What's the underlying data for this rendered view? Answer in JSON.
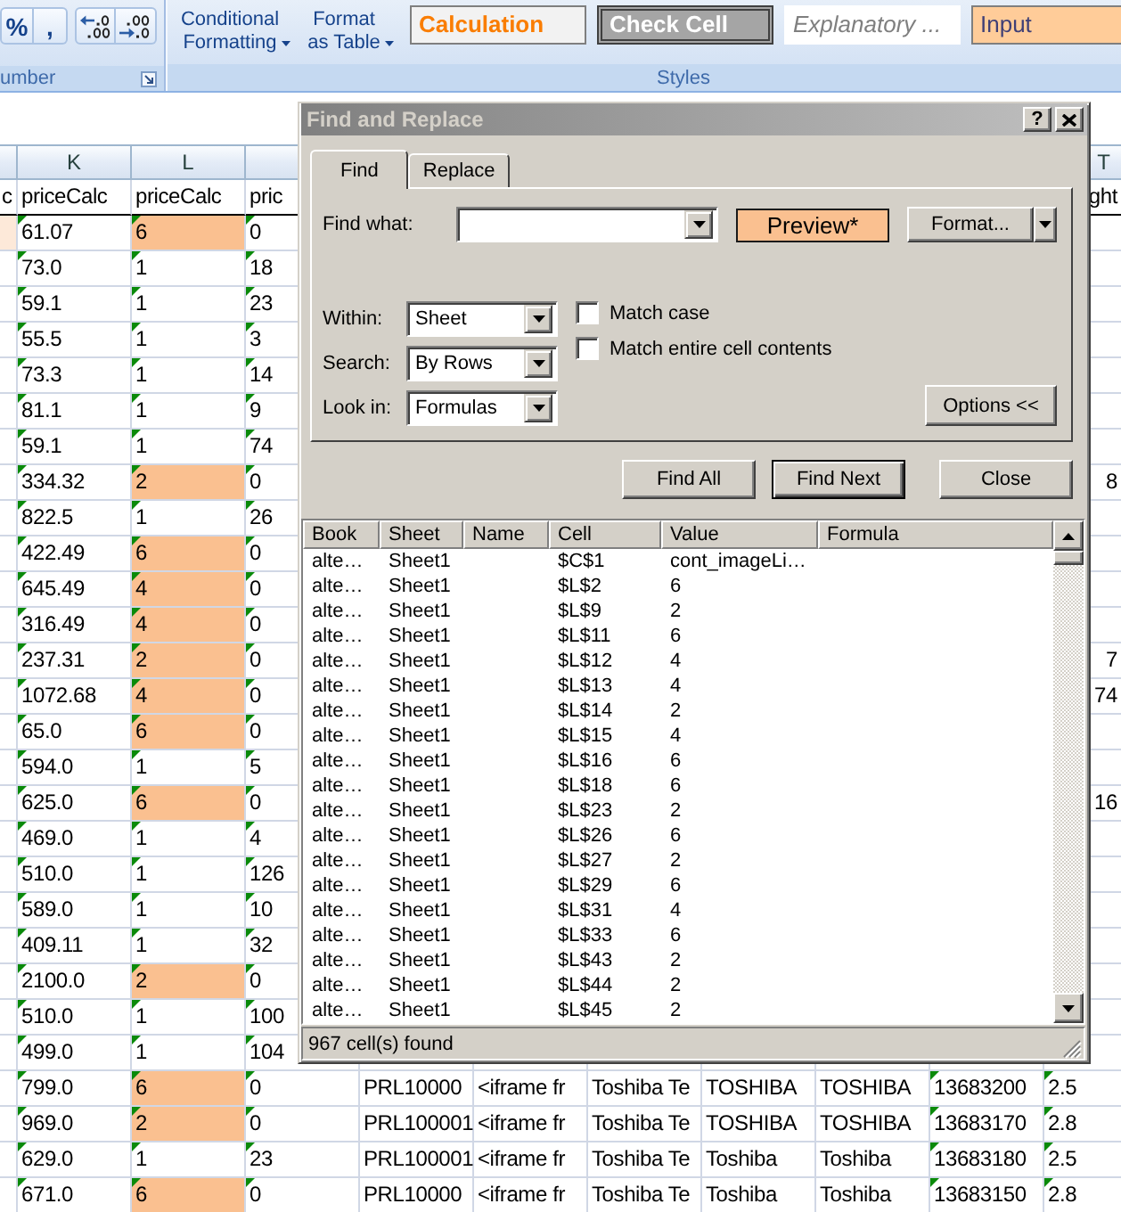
{
  "ribbon": {
    "number_group": {
      "label": "umber",
      "button_sets": [
        {
          "buttons": [
            {
              "kind": "symbol",
              "label": "%"
            },
            {
              "kind": "symbol",
              "label": ","
            }
          ]
        },
        {
          "buttons": [
            {
              "kind": "add_decimal"
            },
            {
              "kind": "remove_decimal"
            }
          ]
        }
      ]
    },
    "styles_group": {
      "label": "Styles",
      "commands": [
        {
          "label": "Conditional Formatting"
        },
        {
          "label": "Format as Table"
        }
      ],
      "cell_styles": [
        {
          "kind": "calculation",
          "label": "Calculation"
        },
        {
          "kind": "check",
          "label": "Check Cell"
        },
        {
          "kind": "explanatory",
          "label": "Explanatory ..."
        },
        {
          "kind": "input",
          "label": "Input"
        }
      ]
    }
  },
  "sheet": {
    "column_headers": [
      {
        "letter": "K"
      },
      {
        "letter": "L"
      }
    ],
    "edge_column_header": {
      "letter": "T"
    },
    "rows": [
      {
        "kind": "header",
        "lead": {
          "text": "c",
          "highlight": false
        },
        "cells": [
          {
            "text": "priceCalc",
            "highlight": false,
            "error_flag": false
          },
          {
            "text": "priceCalc",
            "highlight": false,
            "error_flag": false
          },
          {
            "text": "pric",
            "highlight": false,
            "error_flag": false
          }
        ],
        "edge": {
          "text": "ght"
        }
      },
      {
        "kind": "data",
        "lead": {
          "highlight": true
        },
        "cells": [
          {
            "text": "61.07",
            "highlight": false,
            "error_flag": true
          },
          {
            "text": "6",
            "highlight": true,
            "error_flag": true
          },
          {
            "text": "0",
            "highlight": false,
            "error_flag": true
          }
        ]
      },
      {
        "kind": "data",
        "cells": [
          {
            "text": "73.0",
            "highlight": false,
            "error_flag": true
          },
          {
            "text": "1",
            "highlight": false,
            "error_flag": true
          },
          {
            "text": "18",
            "highlight": false,
            "error_flag": true
          }
        ]
      },
      {
        "kind": "data",
        "cells": [
          {
            "text": "59.1",
            "highlight": false,
            "error_flag": true
          },
          {
            "text": "1",
            "highlight": false,
            "error_flag": true
          },
          {
            "text": "23",
            "highlight": false,
            "error_flag": true
          }
        ]
      },
      {
        "kind": "data",
        "cells": [
          {
            "text": "55.5",
            "highlight": false,
            "error_flag": true
          },
          {
            "text": "1",
            "highlight": false,
            "error_flag": true
          },
          {
            "text": "3",
            "highlight": false,
            "error_flag": true
          }
        ]
      },
      {
        "kind": "data",
        "cells": [
          {
            "text": "73.3",
            "highlight": false,
            "error_flag": true
          },
          {
            "text": "1",
            "highlight": false,
            "error_flag": true
          },
          {
            "text": "14",
            "highlight": false,
            "error_flag": true
          }
        ]
      },
      {
        "kind": "data",
        "cells": [
          {
            "text": "81.1",
            "highlight": false,
            "error_flag": true
          },
          {
            "text": "1",
            "highlight": false,
            "error_flag": true
          },
          {
            "text": "9",
            "highlight": false,
            "error_flag": true
          }
        ]
      },
      {
        "kind": "data",
        "cells": [
          {
            "text": "59.1",
            "highlight": false,
            "error_flag": true
          },
          {
            "text": "1",
            "highlight": false,
            "error_flag": true
          },
          {
            "text": "74",
            "highlight": false,
            "error_flag": true
          }
        ]
      },
      {
        "kind": "data",
        "cells": [
          {
            "text": "334.32",
            "highlight": false,
            "error_flag": true
          },
          {
            "text": "2",
            "highlight": true,
            "error_flag": true
          },
          {
            "text": "0",
            "highlight": false,
            "error_flag": true
          }
        ],
        "edge": {
          "text": "8"
        }
      },
      {
        "kind": "data",
        "cells": [
          {
            "text": "822.5",
            "highlight": false,
            "error_flag": true
          },
          {
            "text": "1",
            "highlight": false,
            "error_flag": true
          },
          {
            "text": "26",
            "highlight": false,
            "error_flag": true
          }
        ]
      },
      {
        "kind": "data",
        "cells": [
          {
            "text": "422.49",
            "highlight": false,
            "error_flag": true
          },
          {
            "text": "6",
            "highlight": true,
            "error_flag": true
          },
          {
            "text": "0",
            "highlight": false,
            "error_flag": true
          }
        ]
      },
      {
        "kind": "data",
        "cells": [
          {
            "text": "645.49",
            "highlight": false,
            "error_flag": true
          },
          {
            "text": "4",
            "highlight": true,
            "error_flag": true
          },
          {
            "text": "0",
            "highlight": false,
            "error_flag": true
          }
        ]
      },
      {
        "kind": "data",
        "cells": [
          {
            "text": "316.49",
            "highlight": false,
            "error_flag": true
          },
          {
            "text": "4",
            "highlight": true,
            "error_flag": true
          },
          {
            "text": "0",
            "highlight": false,
            "error_flag": true
          }
        ]
      },
      {
        "kind": "data",
        "cells": [
          {
            "text": "237.31",
            "highlight": false,
            "error_flag": true
          },
          {
            "text": "2",
            "highlight": true,
            "error_flag": true
          },
          {
            "text": "0",
            "highlight": false,
            "error_flag": true
          }
        ],
        "edge": {
          "text": "7"
        }
      },
      {
        "kind": "data",
        "cells": [
          {
            "text": "1072.68",
            "highlight": false,
            "error_flag": true
          },
          {
            "text": "4",
            "highlight": true,
            "error_flag": true
          },
          {
            "text": "0",
            "highlight": false,
            "error_flag": true
          }
        ],
        "edge": {
          "text": "74"
        }
      },
      {
        "kind": "data",
        "cells": [
          {
            "text": "65.0",
            "highlight": false,
            "error_flag": true
          },
          {
            "text": "6",
            "highlight": true,
            "error_flag": true
          },
          {
            "text": "0",
            "highlight": false,
            "error_flag": true
          }
        ]
      },
      {
        "kind": "data",
        "cells": [
          {
            "text": "594.0",
            "highlight": false,
            "error_flag": true
          },
          {
            "text": "1",
            "highlight": false,
            "error_flag": true
          },
          {
            "text": "5",
            "highlight": false,
            "error_flag": true
          }
        ]
      },
      {
        "kind": "data",
        "cells": [
          {
            "text": "625.0",
            "highlight": false,
            "error_flag": true
          },
          {
            "text": "6",
            "highlight": true,
            "error_flag": true
          },
          {
            "text": "0",
            "highlight": false,
            "error_flag": true
          }
        ],
        "edge": {
          "text": "16"
        }
      },
      {
        "kind": "data",
        "cells": [
          {
            "text": "469.0",
            "highlight": false,
            "error_flag": true
          },
          {
            "text": "1",
            "highlight": false,
            "error_flag": true
          },
          {
            "text": "4",
            "highlight": false,
            "error_flag": true
          }
        ]
      },
      {
        "kind": "data",
        "cells": [
          {
            "text": "510.0",
            "highlight": false,
            "error_flag": true
          },
          {
            "text": "1",
            "highlight": false,
            "error_flag": true
          },
          {
            "text": "126",
            "highlight": false,
            "error_flag": true
          }
        ]
      },
      {
        "kind": "data",
        "cells": [
          {
            "text": "589.0",
            "highlight": false,
            "error_flag": true
          },
          {
            "text": "1",
            "highlight": false,
            "error_flag": true
          },
          {
            "text": "10",
            "highlight": false,
            "error_flag": true
          }
        ]
      },
      {
        "kind": "data",
        "cells": [
          {
            "text": "409.11",
            "highlight": false,
            "error_flag": true
          },
          {
            "text": "1",
            "highlight": false,
            "error_flag": true
          },
          {
            "text": "32",
            "highlight": false,
            "error_flag": true
          }
        ]
      },
      {
        "kind": "data",
        "cells": [
          {
            "text": "2100.0",
            "highlight": false,
            "error_flag": true
          },
          {
            "text": "2",
            "highlight": true,
            "error_flag": true
          },
          {
            "text": "0",
            "highlight": false,
            "error_flag": true
          }
        ]
      },
      {
        "kind": "data",
        "cells": [
          {
            "text": "510.0",
            "highlight": false,
            "error_flag": true
          },
          {
            "text": "1",
            "highlight": false,
            "error_flag": true
          },
          {
            "text": "100",
            "highlight": false,
            "error_flag": true
          }
        ]
      },
      {
        "kind": "data",
        "cells": [
          {
            "text": "499.0",
            "highlight": false,
            "error_flag": true
          },
          {
            "text": "1",
            "highlight": false,
            "error_flag": true
          },
          {
            "text": "104",
            "highlight": false,
            "error_flag": true
          }
        ]
      },
      {
        "kind": "data",
        "cells": [
          {
            "text": "799.0",
            "highlight": false,
            "error_flag": true
          },
          {
            "text": "6",
            "highlight": true,
            "error_flag": true
          },
          {
            "text": "0",
            "highlight": false,
            "error_flag": true
          },
          {
            "text": "PRL10000",
            "highlight": false,
            "error_flag": false
          },
          {
            "text": "<iframe fr",
            "highlight": false,
            "error_flag": false
          },
          {
            "text": "Toshiba Te",
            "highlight": false,
            "error_flag": false
          },
          {
            "text": "TOSHIBA",
            "highlight": false,
            "error_flag": false
          },
          {
            "text": "TOSHIBA",
            "highlight": false,
            "error_flag": false
          },
          {
            "text": "13683200",
            "highlight": false,
            "error_flag": true
          },
          {
            "text": "2.5",
            "highlight": false,
            "error_flag": true
          }
        ]
      },
      {
        "kind": "data",
        "cells": [
          {
            "text": "969.0",
            "highlight": false,
            "error_flag": true
          },
          {
            "text": "2",
            "highlight": true,
            "error_flag": true
          },
          {
            "text": "0",
            "highlight": false,
            "error_flag": true
          },
          {
            "text": "PRL100001",
            "highlight": false,
            "error_flag": false
          },
          {
            "text": "<iframe fr",
            "highlight": false,
            "error_flag": false
          },
          {
            "text": "Toshiba Te",
            "highlight": false,
            "error_flag": false
          },
          {
            "text": "TOSHIBA",
            "highlight": false,
            "error_flag": false
          },
          {
            "text": "TOSHIBA",
            "highlight": false,
            "error_flag": false
          },
          {
            "text": "13683170",
            "highlight": false,
            "error_flag": true
          },
          {
            "text": "2.8",
            "highlight": false,
            "error_flag": true
          }
        ]
      },
      {
        "kind": "data",
        "cells": [
          {
            "text": "629.0",
            "highlight": false,
            "error_flag": true
          },
          {
            "text": "1",
            "highlight": false,
            "error_flag": true
          },
          {
            "text": "23",
            "highlight": false,
            "error_flag": true
          },
          {
            "text": "PRL100001",
            "highlight": false,
            "error_flag": false
          },
          {
            "text": "<iframe fr",
            "highlight": false,
            "error_flag": false
          },
          {
            "text": "Toshiba Te",
            "highlight": false,
            "error_flag": false
          },
          {
            "text": "Toshiba",
            "highlight": false,
            "error_flag": false
          },
          {
            "text": "Toshiba",
            "highlight": false,
            "error_flag": false
          },
          {
            "text": "13683180",
            "highlight": false,
            "error_flag": true
          },
          {
            "text": "2.5",
            "highlight": false,
            "error_flag": true
          }
        ]
      },
      {
        "kind": "data",
        "cells": [
          {
            "text": "671.0",
            "highlight": false,
            "error_flag": true
          },
          {
            "text": "6",
            "highlight": true,
            "error_flag": true
          },
          {
            "text": "0",
            "highlight": false,
            "error_flag": true
          },
          {
            "text": "PRL10000",
            "highlight": false,
            "error_flag": false
          },
          {
            "text": "<iframe fr",
            "highlight": false,
            "error_flag": false
          },
          {
            "text": "Toshiba Te",
            "highlight": false,
            "error_flag": false
          },
          {
            "text": "Toshiba",
            "highlight": false,
            "error_flag": false
          },
          {
            "text": "Toshiba",
            "highlight": false,
            "error_flag": false
          },
          {
            "text": "13683150",
            "highlight": false,
            "error_flag": true
          },
          {
            "text": "2.8",
            "highlight": false,
            "error_flag": true
          }
        ]
      }
    ]
  },
  "dialog": {
    "title": "Find and Replace",
    "help_button": "?",
    "tabs": [
      {
        "label": "Find",
        "selected": true
      },
      {
        "label": "Replace",
        "selected": false
      }
    ],
    "find_what": {
      "label": "Find what:"
    },
    "format_preview": "Preview*",
    "format_button": "Format...",
    "options": [
      {
        "label": "Within:",
        "value": "Sheet"
      },
      {
        "label": "Search:",
        "value": "By Rows"
      },
      {
        "label": "Look in:",
        "value": "Formulas"
      }
    ],
    "checkboxes": [
      {
        "label": "Match case",
        "checked": false
      },
      {
        "label": "Match entire cell contents",
        "checked": false
      }
    ],
    "options_button": "Options <<",
    "buttons": [
      {
        "label": "Find All",
        "default": false
      },
      {
        "label": "Find Next",
        "default": true
      },
      {
        "label": "Close",
        "default": false
      }
    ],
    "results": {
      "columns": [
        "Book",
        "Sheet",
        "Name",
        "Cell",
        "Value",
        "Formula"
      ],
      "rows": [
        {
          "book": "alte…",
          "sheet": "Sheet1",
          "cell": "$C$1",
          "value": "cont_imageLi…"
        },
        {
          "book": "alte…",
          "sheet": "Sheet1",
          "cell": "$L$2",
          "value": "6"
        },
        {
          "book": "alte…",
          "sheet": "Sheet1",
          "cell": "$L$9",
          "value": "2"
        },
        {
          "book": "alte…",
          "sheet": "Sheet1",
          "cell": "$L$11",
          "value": "6"
        },
        {
          "book": "alte…",
          "sheet": "Sheet1",
          "cell": "$L$12",
          "value": "4"
        },
        {
          "book": "alte…",
          "sheet": "Sheet1",
          "cell": "$L$13",
          "value": "4"
        },
        {
          "book": "alte…",
          "sheet": "Sheet1",
          "cell": "$L$14",
          "value": "2"
        },
        {
          "book": "alte…",
          "sheet": "Sheet1",
          "cell": "$L$15",
          "value": "4"
        },
        {
          "book": "alte…",
          "sheet": "Sheet1",
          "cell": "$L$16",
          "value": "6"
        },
        {
          "book": "alte…",
          "sheet": "Sheet1",
          "cell": "$L$18",
          "value": "6"
        },
        {
          "book": "alte…",
          "sheet": "Sheet1",
          "cell": "$L$23",
          "value": "2"
        },
        {
          "book": "alte…",
          "sheet": "Sheet1",
          "cell": "$L$26",
          "value": "6"
        },
        {
          "book": "alte…",
          "sheet": "Sheet1",
          "cell": "$L$27",
          "value": "2"
        },
        {
          "book": "alte…",
          "sheet": "Sheet1",
          "cell": "$L$29",
          "value": "6"
        },
        {
          "book": "alte…",
          "sheet": "Sheet1",
          "cell": "$L$31",
          "value": "4"
        },
        {
          "book": "alte…",
          "sheet": "Sheet1",
          "cell": "$L$33",
          "value": "6"
        },
        {
          "book": "alte…",
          "sheet": "Sheet1",
          "cell": "$L$43",
          "value": "2"
        },
        {
          "book": "alte…",
          "sheet": "Sheet1",
          "cell": "$L$44",
          "value": "2"
        },
        {
          "book": "alte…",
          "sheet": "Sheet1",
          "cell": "$L$45",
          "value": "2"
        }
      ]
    },
    "status": "967 cell(s) found"
  }
}
